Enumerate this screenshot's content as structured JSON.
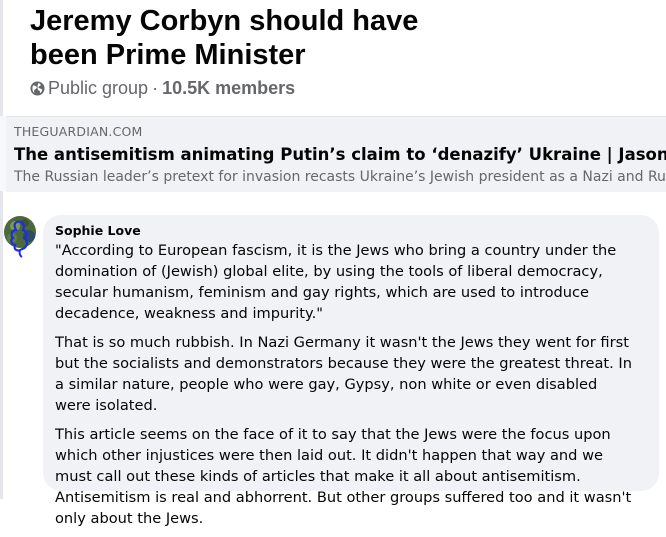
{
  "group": {
    "title_line1": "Jeremy Corbyn should have",
    "title_line2": "been Prime Minister",
    "privacy": "Public group",
    "separator": "·",
    "members": "10.5K members",
    "privacy_icon": "globe-icon"
  },
  "link_preview": {
    "domain": "THEGUARDIAN.COM",
    "title": "The antisemitism animating Putin’s claim to ‘denazify’ Ukraine | Jason Stanley",
    "description": "The Russian leader’s pretext for invasion recasts Ukraine’s Jewish president as a Nazi and Russ"
  },
  "comment": {
    "author": "Sophie Love",
    "avatar_icon": "avatar",
    "paragraphs": [
      "\"According to European fascism, it is the Jews who bring a country under the domination of (Jewish) global elite, by using the tools of liberal democracy, secular humanism, feminism and gay rights, which are used to introduce decadence, weakness and impurity.\"",
      "That is so much rubbish. In Nazi Germany it wasn't the Jews they went for first but the socialists and demonstrators because they were the greatest threat. In a similar nature, people who were gay, Gypsy, non white or even disabled were isolated.",
      "This article seems on the face of it to say that the Jews were the focus upon which other injustices were then laid out. It didn't happen that way and we must call out these kinds of articles that make it all about antisemitism. Antisemitism is real and abhorrent. But other groups suffered too and it wasn't only about the Jews."
    ]
  }
}
